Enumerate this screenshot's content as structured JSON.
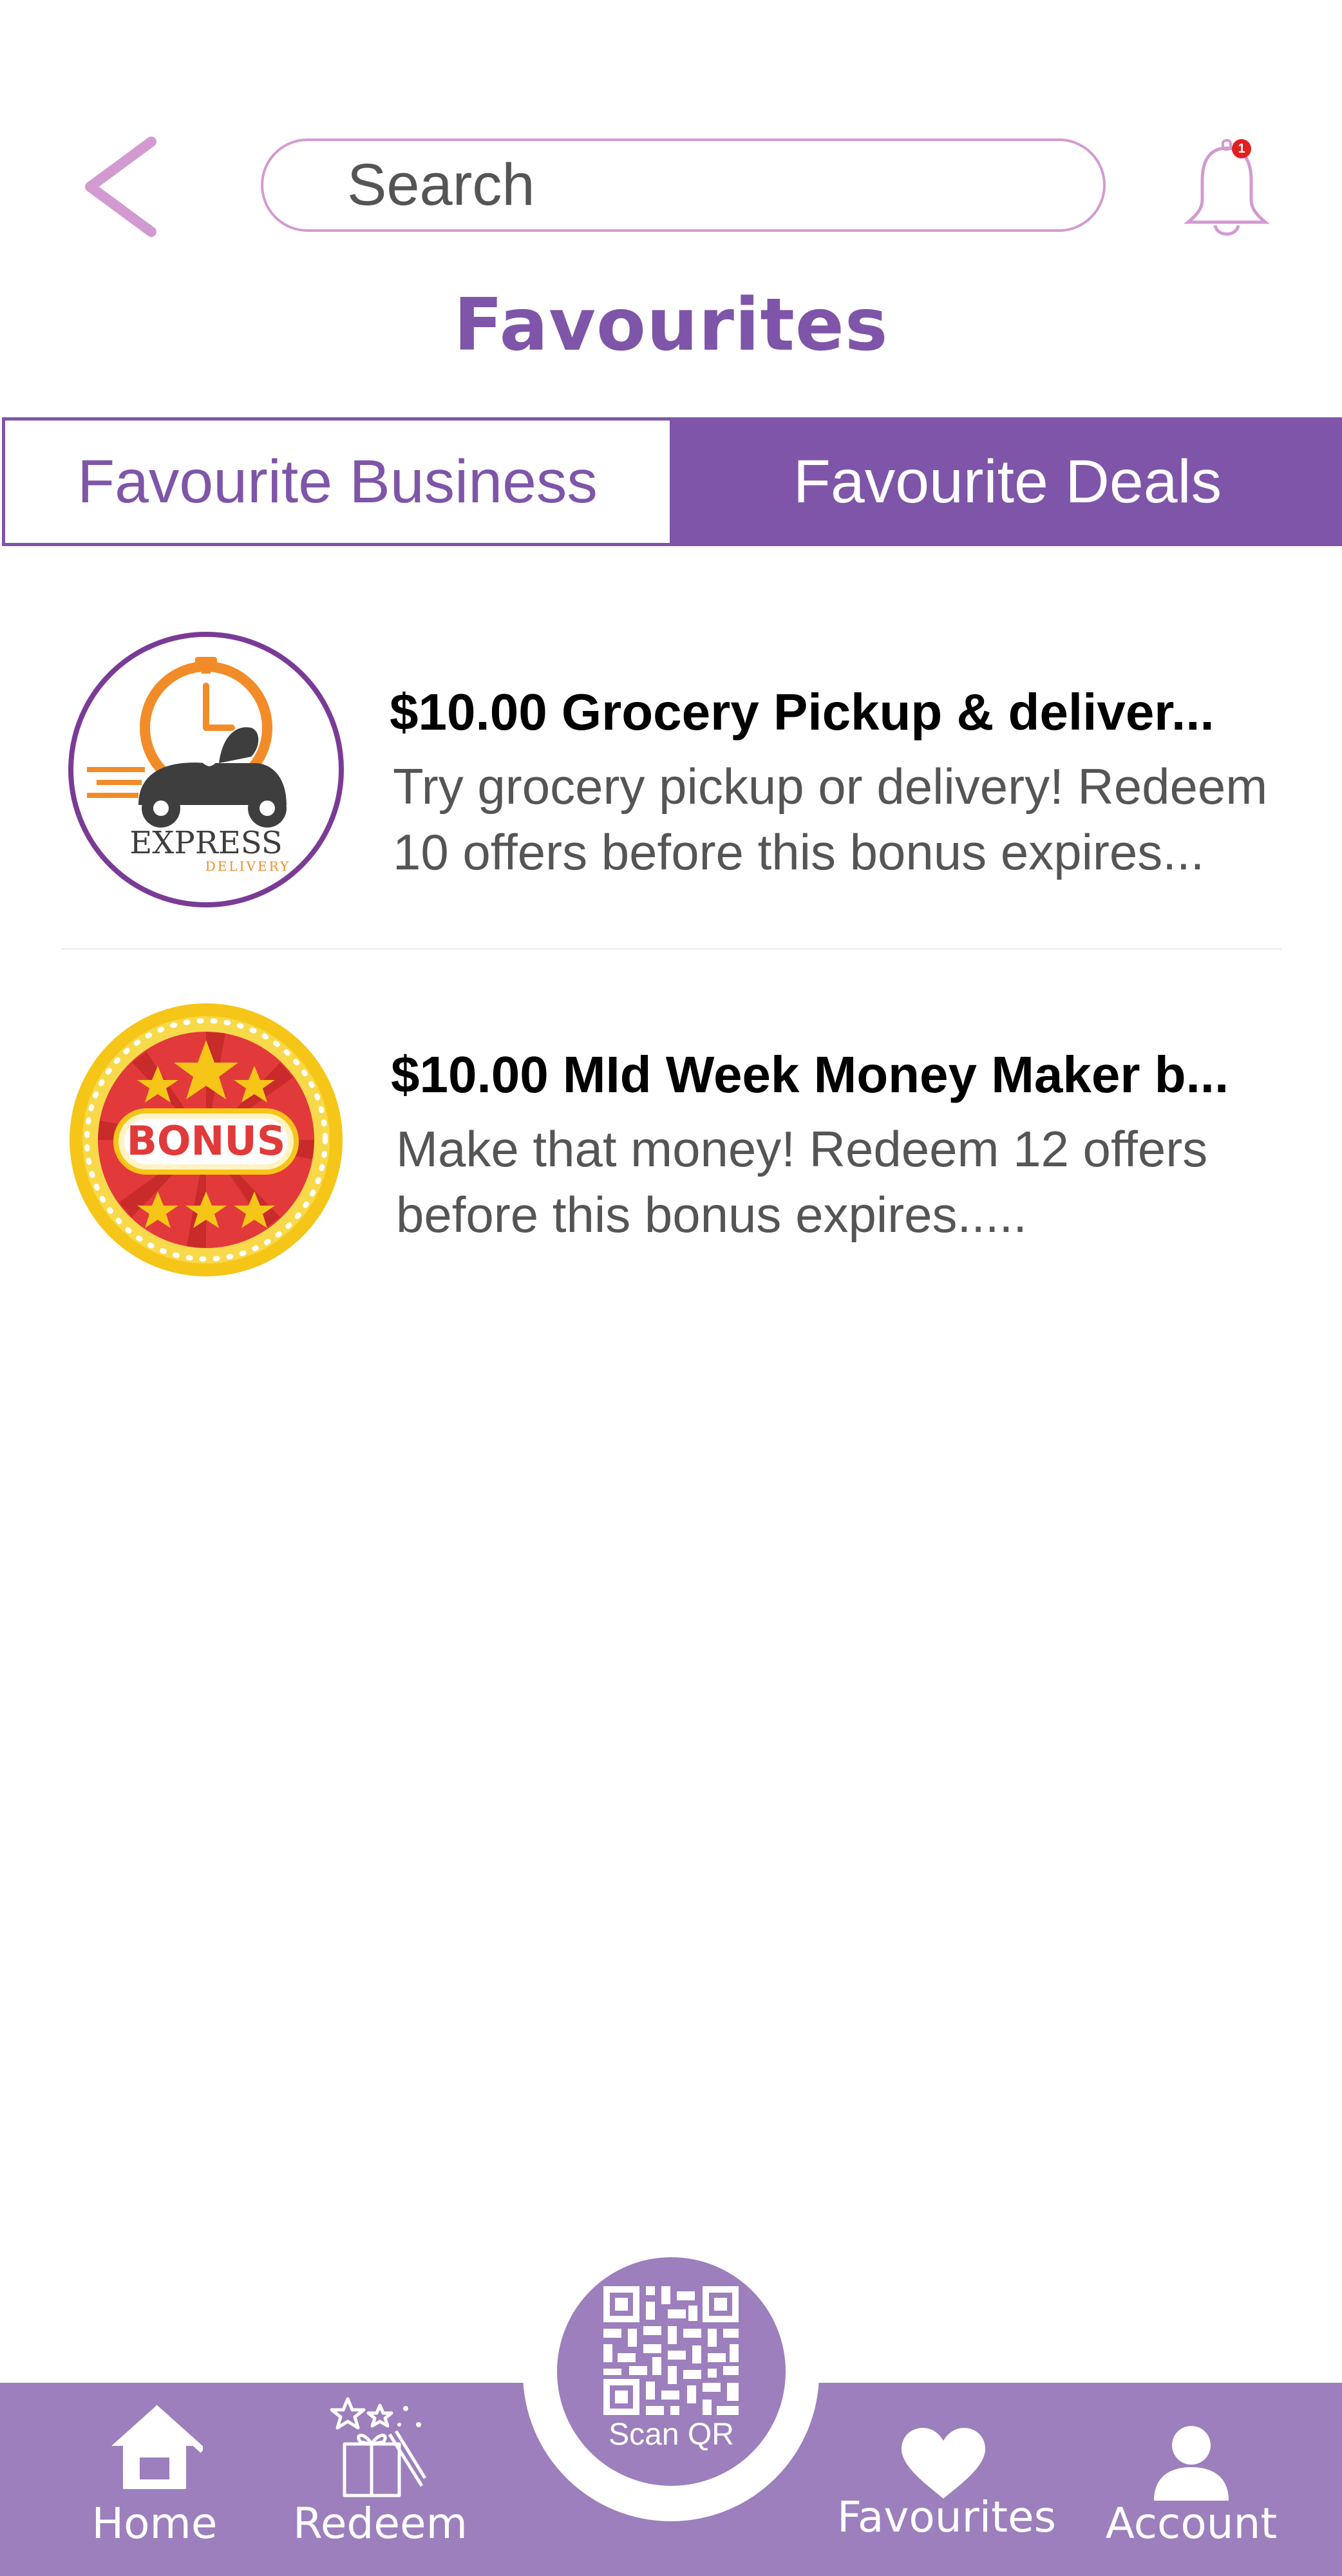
{
  "header": {
    "search_placeholder": "Search",
    "notification_count": "1",
    "title": "Favourites"
  },
  "tabs": [
    {
      "label": "Favourite Business",
      "active": false
    },
    {
      "label": "Favourite Deals",
      "active": true
    }
  ],
  "deals": [
    {
      "title": "$10.00 Grocery Pickup & deliver...",
      "description": "Try grocery pickup or delivery! Redeem 10 offers before this bonus expires...",
      "logo": {
        "icon": "express-delivery-logo",
        "text": "EXPRESS",
        "subtext": "DELIVERY"
      }
    },
    {
      "title": "$10.00 MId Week Money Maker b...",
      "description": "Make that money! Redeem 12 offers before this bonus expires.....",
      "logo": {
        "icon": "bonus-badge-logo",
        "text": "BONUS"
      }
    }
  ],
  "nav": {
    "home": "Home",
    "redeem": "Redeem",
    "scan": "Scan QR",
    "favourites": "Favourites",
    "account": "Account"
  },
  "colors": {
    "primary": "#7e55a8",
    "nav_bg": "#9c7fbc",
    "accent_pink": "#d39ad2",
    "badge_red": "#e02020"
  }
}
